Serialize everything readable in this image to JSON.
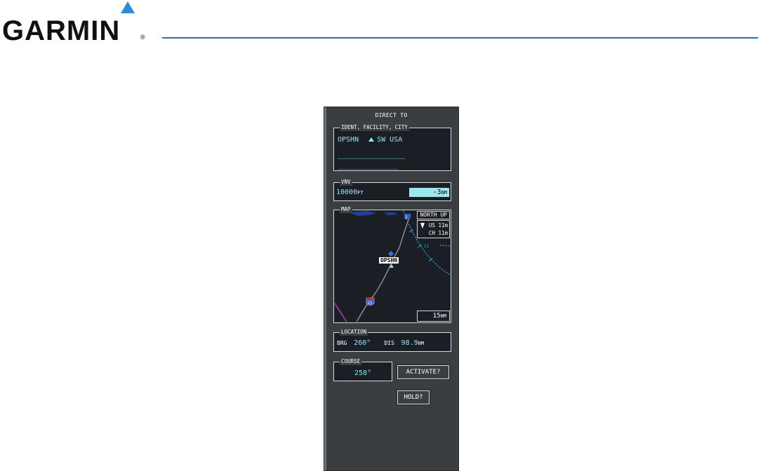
{
  "brand": {
    "name": "GARMIN",
    "registered": "®"
  },
  "panel": {
    "title": "DIRECT TO",
    "ident": {
      "label": "IDENT, FACILITY, CITY",
      "ident": "OPSHN",
      "city": "SW USA",
      "facility_placeholder": "________________",
      "city_placeholder": "__________________"
    },
    "vnv": {
      "label": "VNV",
      "altitude": "10000",
      "altitude_unit": "FT",
      "offset": "-3",
      "offset_unit": "NM"
    },
    "map": {
      "label": "MAP",
      "orientation": "NORTH UP",
      "wind_us_label": "US",
      "wind_us_value": "11m",
      "wind_ch_label": "CH",
      "wind_ch_value": "11m",
      "waypoint": "OPSHN",
      "highway_shield": "25",
      "airport_id": "2",
      "compass_mark": "21",
      "range": "15",
      "range_unit": "NM"
    },
    "location": {
      "label": "LOCATION",
      "brg_label": "BRG",
      "brg_value": "260°",
      "dis_label": "DIS",
      "dis_value": "98.9",
      "dis_unit": "NM"
    },
    "course": {
      "label": "COURSE",
      "value": "258°"
    },
    "buttons": {
      "activate": "ACTIVATE?",
      "hold": "HOLD?"
    }
  },
  "colors": {
    "accent_blue": "#1f6fba",
    "cyan": "#8ee7f2",
    "panel_bg": "#3b3e41",
    "screen_bg": "#1c1e25"
  }
}
